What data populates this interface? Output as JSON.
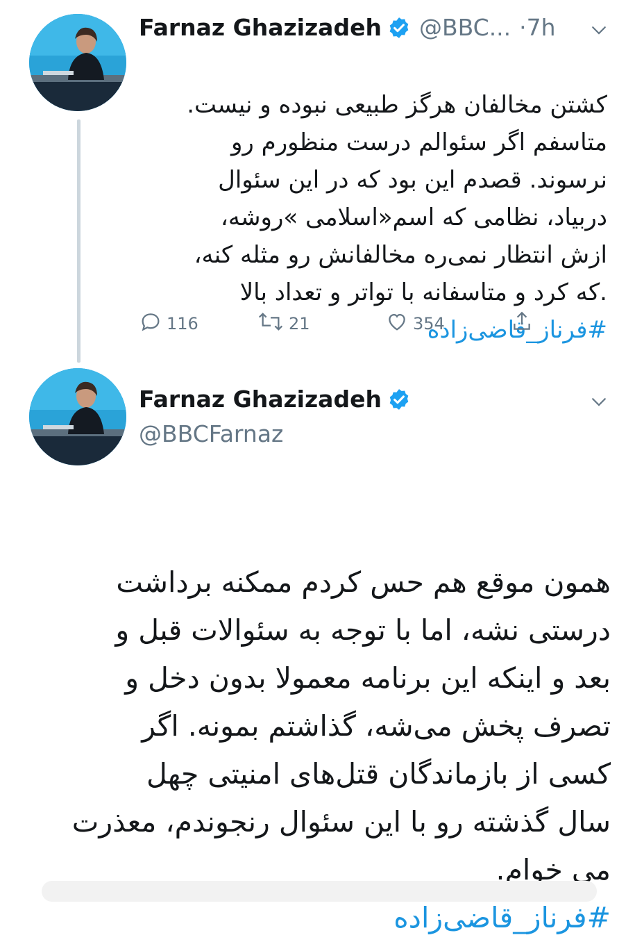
{
  "tweet1": {
    "name": "Farnaz Ghazizadeh",
    "handle": "@BBC...",
    "time": "·7h",
    "text": "کشتن مخالفان هرگز طبیعی نبوده و نیست.\nمتاسفم اگر سئوالم درست منظورم رو\nنرسوند. قصدم این بود که در این سئوال\nدربیاد، نظامی که اسم«اسلامی »روشه،\nازش انتظار نمی‌ره مخالفانش رو مثله کنه،\n.که کرد و متاسفانه با تواتر و تعداد بالا",
    "hashtag": "#فرناز_قاضی‌زاده",
    "replies": "116",
    "retweets": "21",
    "likes": "354"
  },
  "tweet2": {
    "name": "Farnaz Ghazizadeh",
    "handle": "@BBCFarnaz",
    "text": "همون موقع هم حس کردم ممکنه برداشت\nدرستی نشه، اما با توجه به سئوالات قبل و\nبعد و اینکه این برنامه معمولا بدون دخل و\nتصرف پخش می‌شه، گذاشتم بمونه. اگر\nکسی از  بازماندگان قتل‌های امنیتی چهل\nسال گذشته رو با این سئوال رنجوندم، معذرت\nمی خوام.",
    "hashtag": "#فرناز_قاضی‌زاده"
  },
  "colors": {
    "accent": "#1da1f2",
    "hashtag": "#1b95e0",
    "muted": "#657786"
  },
  "icons": [
    "verified-badge-icon",
    "chevron-down-icon",
    "reply-icon",
    "retweet-icon",
    "like-icon",
    "share-icon"
  ]
}
